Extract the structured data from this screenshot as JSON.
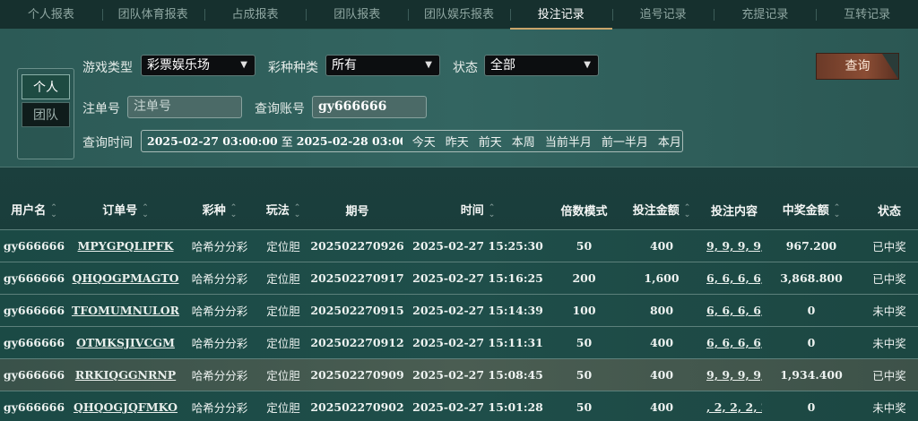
{
  "tabs": [
    {
      "label": "个人报表",
      "active": false
    },
    {
      "label": "团队体育报表",
      "active": false
    },
    {
      "label": "占成报表",
      "active": false
    },
    {
      "label": "团队报表",
      "active": false
    },
    {
      "label": "团队娱乐报表",
      "active": false
    },
    {
      "label": "投注记录",
      "active": true
    },
    {
      "label": "追号记录",
      "active": false
    },
    {
      "label": "充提记录",
      "active": false
    },
    {
      "label": "互转记录",
      "active": false
    }
  ],
  "scope": {
    "personal": "个人",
    "team": "团队"
  },
  "filters": {
    "game_type_label": "游戏类型",
    "game_type_value": "彩票娱乐场",
    "lottery_label": "彩种种类",
    "lottery_value": "所有",
    "status_label": "状态",
    "status_value": "全部",
    "order_label": "注单号",
    "order_placeholder": "注单号",
    "account_label": "查询账号",
    "account_value": "gy666666",
    "time_label": "查询时间",
    "time_from": "2025-02-27 03:00:00",
    "time_sep": "至",
    "time_to": "2025-02-28 03:00:00",
    "quick": [
      "今天",
      "昨天",
      "前天",
      "本周",
      "当前半月",
      "前一半月",
      "本月"
    ],
    "search_label": "查询"
  },
  "table": {
    "columns": [
      "用户名",
      "订单号",
      "彩种",
      "玩法",
      "期号",
      "时间",
      "倍数模式",
      "投注金额",
      "投注内容",
      "中奖金额",
      "状态"
    ],
    "rows": [
      {
        "user": "gy666666",
        "order": "MPYGPQLIPFK",
        "lottery": "哈希分分彩",
        "play": "定位胆",
        "issue": "202502270926",
        "time": "2025-02-27 15:25:30",
        "mult": "50",
        "amount": "400",
        "content": "9, 9, 9, 9,",
        "win": "967.200",
        "status": "已中奖"
      },
      {
        "user": "gy666666",
        "order": "QHQOGPMAGTO",
        "lottery": "哈希分分彩",
        "play": "定位胆",
        "issue": "202502270917",
        "time": "2025-02-27 15:16:25",
        "mult": "200",
        "amount": "1,600",
        "content": "6, 6, 6, 6,",
        "win": "3,868.800",
        "status": "已中奖"
      },
      {
        "user": "gy666666",
        "order": "TFOMUMNULOR",
        "lottery": "哈希分分彩",
        "play": "定位胆",
        "issue": "202502270915",
        "time": "2025-02-27 15:14:39",
        "mult": "100",
        "amount": "800",
        "content": "6, 6, 6, 6,",
        "win": "0",
        "status": "未中奖"
      },
      {
        "user": "gy666666",
        "order": "OTMKSJIVCGM",
        "lottery": "哈希分分彩",
        "play": "定位胆",
        "issue": "202502270912",
        "time": "2025-02-27 15:11:31",
        "mult": "50",
        "amount": "400",
        "content": "6, 6, 6, 6,",
        "win": "0",
        "status": "未中奖"
      },
      {
        "user": "gy666666",
        "order": "RRKIQGGNRNP",
        "lottery": "哈希分分彩",
        "play": "定位胆",
        "issue": "202502270909",
        "time": "2025-02-27 15:08:45",
        "mult": "50",
        "amount": "400",
        "content": "9, 9, 9, 9,",
        "win": "1,934.400",
        "status": "已中奖"
      },
      {
        "user": "gy666666",
        "order": "QHQOGJQFMKO",
        "lottery": "哈希分分彩",
        "play": "定位胆",
        "issue": "202502270902",
        "time": "2025-02-27 15:01:28",
        "mult": "50",
        "amount": "400",
        "content": ", 2, 2, 2, 2",
        "win": "0",
        "status": "未中奖"
      }
    ]
  },
  "colors": {
    "accent": "#c9a46a",
    "search_button": "#8b4d34",
    "background": "#1f4a47"
  }
}
